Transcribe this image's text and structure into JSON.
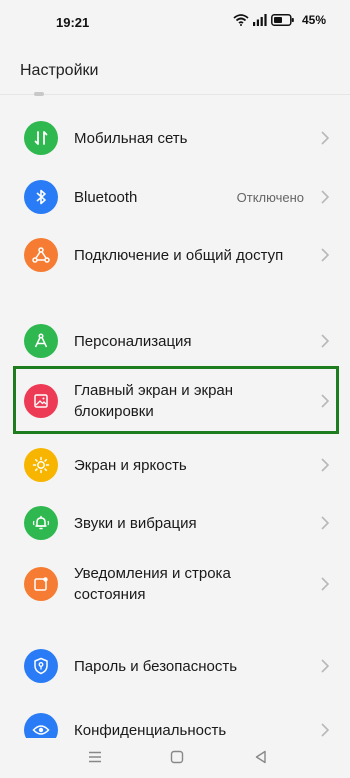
{
  "status": {
    "time": "19:21",
    "battery_percent": "45%",
    "icons": [
      "wifi-icon",
      "signal-icon",
      "battery-icon"
    ]
  },
  "header": {
    "title": "Настройки"
  },
  "settings": {
    "items": [
      {
        "label": "Мобильная сеть",
        "icon": "mobile-network-icon",
        "color": "#2fb84f"
      },
      {
        "label": "Bluetooth",
        "value": "Отключено",
        "icon": "bluetooth-icon",
        "color": "#2a7cf6"
      },
      {
        "label": "Подключение и общий доступ",
        "icon": "connection-sharing-icon",
        "color": "#f57c32"
      },
      {
        "label": "Персонализация",
        "icon": "personalization-icon",
        "color": "#2fb84f"
      },
      {
        "label": "Главный экран и экран блокировки",
        "label_line1": "Главный экран и экран",
        "label_line2": "блокировки",
        "icon": "home-lock-screen-icon",
        "color": "#ee3b55",
        "highlighted": true
      },
      {
        "label": "Экран и яркость",
        "icon": "display-brightness-icon",
        "color": "#f7b500"
      },
      {
        "label": "Звуки и вибрация",
        "icon": "sound-vibration-icon",
        "color": "#2fb84f"
      },
      {
        "label": "Уведомления и строка состояния",
        "label_line1": "Уведомления и строка",
        "label_line2": "состояния",
        "icon": "notifications-icon",
        "color": "#f57c32"
      },
      {
        "label": "Пароль и безопасность",
        "icon": "password-security-icon",
        "color": "#2a7cf6"
      },
      {
        "label": "Конфиденциальность",
        "icon": "privacy-icon",
        "color": "#2a7cf6"
      }
    ]
  },
  "highlight_color": "#1e7d1e",
  "navbar": {
    "buttons": [
      "menu-icon",
      "home-icon",
      "back-icon"
    ]
  }
}
